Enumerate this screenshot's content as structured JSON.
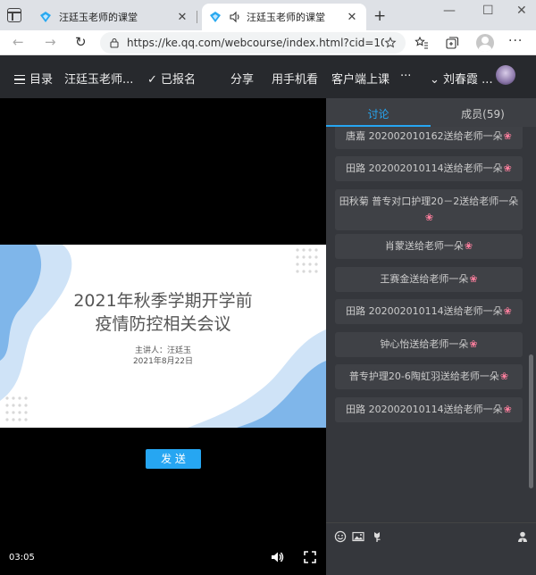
{
  "browser": {
    "tabs": [
      {
        "title": "汪廷玉老师的课堂",
        "active": false
      },
      {
        "title": "汪廷玉老师的课堂",
        "active": true
      }
    ],
    "url": "https://ke.qq.com/webcourse/index.html?cid=105512..."
  },
  "header": {
    "menu_label": "目录",
    "course_title": "汪廷玉老师...",
    "enrolled_label": "已报名",
    "share_label": "分享",
    "mobile_label": "用手机看",
    "client_label": "客户端上课",
    "more_label": "···",
    "user_name": "刘春霞 ..."
  },
  "slide": {
    "title_line1": "2021年秋季学期开学前",
    "title_line2": "疫情防控相关会议",
    "presenter": "主讲人：汪廷玉",
    "date": "2021年8月22日"
  },
  "player": {
    "time": "03:05"
  },
  "panel": {
    "tab_discussion": "讨论",
    "tab_members": "成员(59)",
    "messages": [
      "唐嘉 202002010162送给老师一朵",
      "田路 202002010114送给老师一朵",
      "田秋菊 普专对口护理20－2送给老师一朵",
      "肖蒙送给老师一朵",
      "王赛金送给老师一朵",
      "田路 202002010114送给老师一朵",
      "钟心怡送给老师一朵",
      "普专护理20-6陶虹羽送给老师一朵",
      "田路 202002010114送给老师一朵"
    ],
    "send_label": "发 送"
  },
  "colors": {
    "accent": "#26a6f2",
    "header_bg": "#27292d",
    "panel_bg": "#35373c",
    "flower": "#ff7f9e"
  }
}
